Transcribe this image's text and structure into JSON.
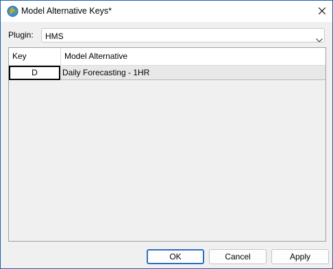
{
  "window": {
    "title": "Model Alternative Keys*",
    "icon": "app-globe-icon"
  },
  "plugin": {
    "label": "Plugin:",
    "value": "HMS"
  },
  "table": {
    "columns": [
      "Key",
      "Model Alternative"
    ],
    "rows": [
      {
        "key": "D",
        "model_alternative": "Daily Forecasting - 1HR"
      }
    ]
  },
  "buttons": {
    "ok": "OK",
    "cancel": "Cancel",
    "apply": "Apply"
  },
  "colors": {
    "accent": "#2a6fc4",
    "window_border": "#1b5fb0",
    "background": "#f0f0f0"
  }
}
